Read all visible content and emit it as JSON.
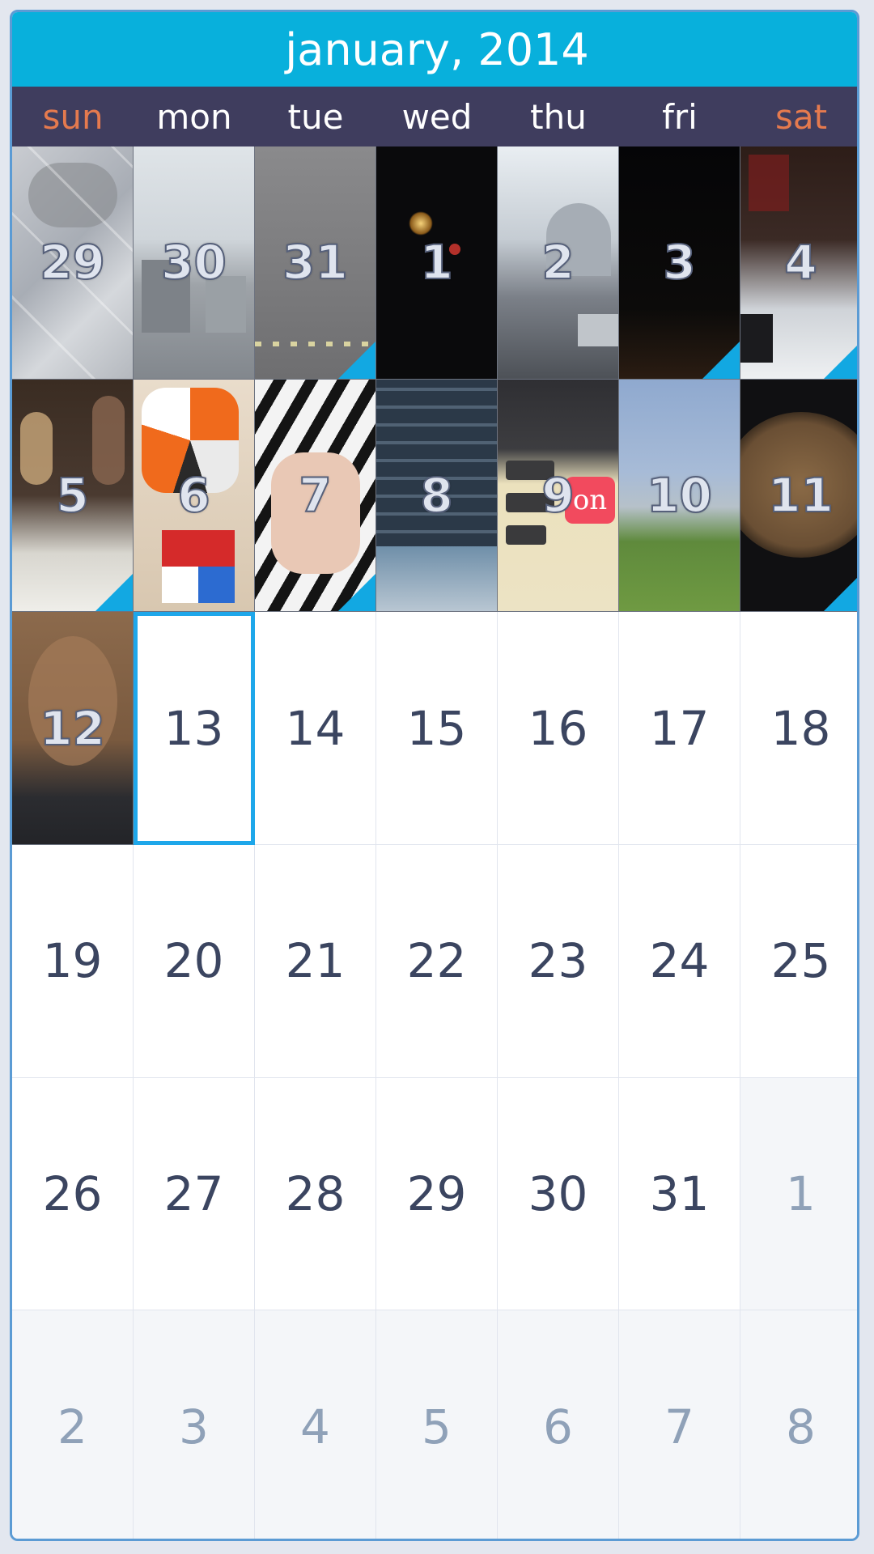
{
  "calendar": {
    "title": "january, 2014",
    "weekdays": [
      "sun",
      "mon",
      "tue",
      "wed",
      "thu",
      "fri",
      "sat"
    ],
    "weekend_color": "#e57a4e",
    "accent_color": "#08b0dc",
    "today": "13",
    "weeks": [
      [
        "29",
        "30",
        "31",
        "1",
        "2",
        "3",
        "4"
      ],
      [
        "5",
        "6",
        "7",
        "8",
        "9",
        "10",
        "11"
      ],
      [
        "12",
        "13",
        "14",
        "15",
        "16",
        "17",
        "18"
      ],
      [
        "19",
        "20",
        "21",
        "22",
        "23",
        "24",
        "25"
      ],
      [
        "26",
        "27",
        "28",
        "29",
        "30",
        "31",
        "1"
      ],
      [
        "2",
        "3",
        "4",
        "5",
        "6",
        "7",
        "8"
      ]
    ],
    "photo_thumbnails": [
      "cats-on-tile",
      "city-street",
      "gray-blur",
      "fireworks",
      "stadium-street",
      "dark-night",
      "party-table",
      "friends-at-table",
      "megaminx-and-rubiks-cube",
      "piano-keys-hand",
      "code-screen",
      "app-stickers",
      "mountain-sky",
      "bowl-of-soup",
      "orange-cat"
    ],
    "sticker_text": "on"
  }
}
